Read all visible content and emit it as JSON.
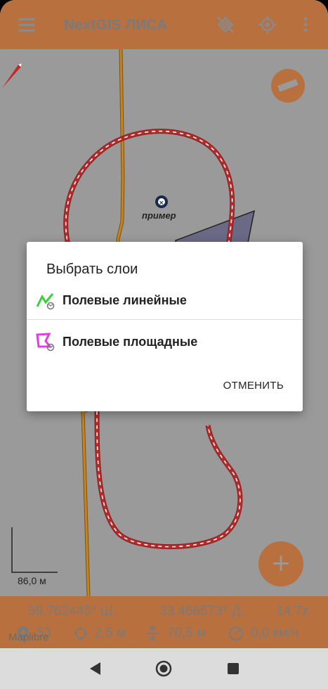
{
  "appbar": {
    "title": "NextGIS ЛИСА",
    "icons": [
      "menu-icon",
      "satellite-off-icon",
      "gps-target-icon",
      "more-vert-icon"
    ]
  },
  "map": {
    "point_label": "пример",
    "scale_label": "86,0 м",
    "fab_add_label": "+"
  },
  "status": {
    "latitude": "59,762445° Ш.",
    "longitude": "33,466573° Д.",
    "zoom": "14.7z",
    "satellites": "53",
    "accuracy": "2,5 м",
    "altitude": "70,5 м",
    "speed": "0,0 км/ч",
    "watermark": "Maplibre"
  },
  "dialog": {
    "title": "Выбрать слои",
    "items": [
      {
        "label": "Полевые линейные",
        "icon": "line-layer-icon"
      },
      {
        "label": "Полевые площадные",
        "icon": "polygon-layer-icon"
      }
    ],
    "cancel_label": "ОТМЕНИТЬ"
  },
  "colors": {
    "accent": "#b8703f",
    "track_red": "#b52a2a",
    "line_orange": "#c8841a",
    "line_layer_green": "#3bd13b",
    "polygon_layer_pink": "#e23ee2"
  }
}
